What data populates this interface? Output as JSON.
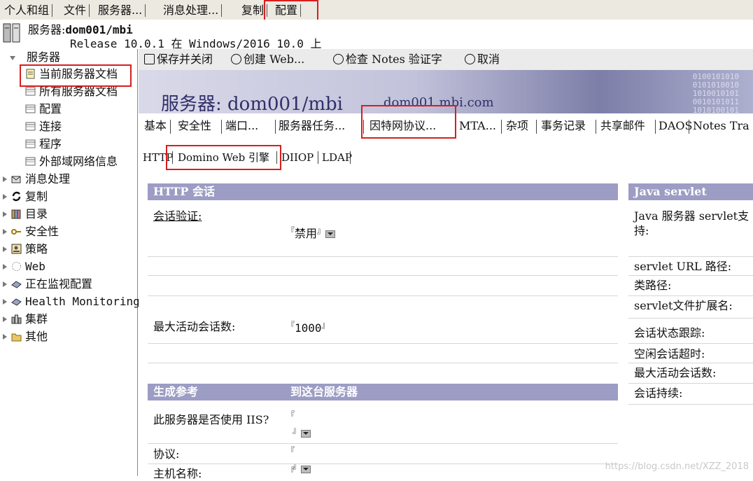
{
  "top_tabs": [
    "个人和组",
    "文件",
    "服务器...",
    "消息处理...",
    "复制",
    "配置"
  ],
  "server_header": {
    "name_prefix": "服务器:",
    "name": "dom001/mbi",
    "release": "Release 10.0.1 在 Windows/2016 10.0 上"
  },
  "tree": {
    "root": "服务器",
    "children": [
      "当前服务器文档",
      "所有服务器文档",
      "配置",
      "连接",
      "程序",
      "外部域网络信息"
    ],
    "top_nodes": [
      "消息处理",
      "复制",
      "目录",
      "安全性",
      "策略",
      "Web",
      "正在监视配置",
      "Health Monitoring",
      "集群",
      "其他"
    ]
  },
  "actions": {
    "save_close": "保存并关闭",
    "create_web": "创建 Web...",
    "check_notes": "检查 Notes 验证字",
    "cancel": "取消"
  },
  "banner": {
    "title": "服务器: dom001/mbi",
    "domain": "dom001.mbi.com"
  },
  "doc_tabs": [
    "基本",
    "安全性",
    "端口...",
    "服务器任务...",
    "因特网协议...",
    "MTA...",
    "杂项",
    "事务记录",
    "共享邮件",
    "DAOS",
    "Notes Tra"
  ],
  "sub_tabs": [
    "HTTP",
    "Domino Web 引擎",
    "DIIOP",
    "LDAP"
  ],
  "http_session": {
    "title": "HTTP 会话",
    "auth_label": "会话验证:",
    "auth_value": "禁用",
    "max_sessions_label": "最大活动会话数:",
    "max_sessions_value": "1000"
  },
  "java_servlet": {
    "title": "Java servlet",
    "support_label": "Java 服务器 servlet支持:",
    "url_path_label": "servlet URL 路径:",
    "class_path_label": "类路径:",
    "ext_label": "servlet文件扩展名:",
    "tracking_label": "会话状态跟踪:",
    "idle_timeout_label": "空闲会话超时:",
    "max_sessions_label": "最大活动会话数:",
    "persist_label": "会话持续:"
  },
  "generate_refs": {
    "title": "生成参考",
    "target": "到这台服务器",
    "iis_label": "此服务器是否使用 IIS?",
    "protocol_label": "协议:",
    "host_label": "主机名称:"
  },
  "watermark": "https://blog.csdn.net/XZZ_2018",
  "colors": {
    "section_bar": "#9c9cc4",
    "highlight": "#d81e1e"
  }
}
